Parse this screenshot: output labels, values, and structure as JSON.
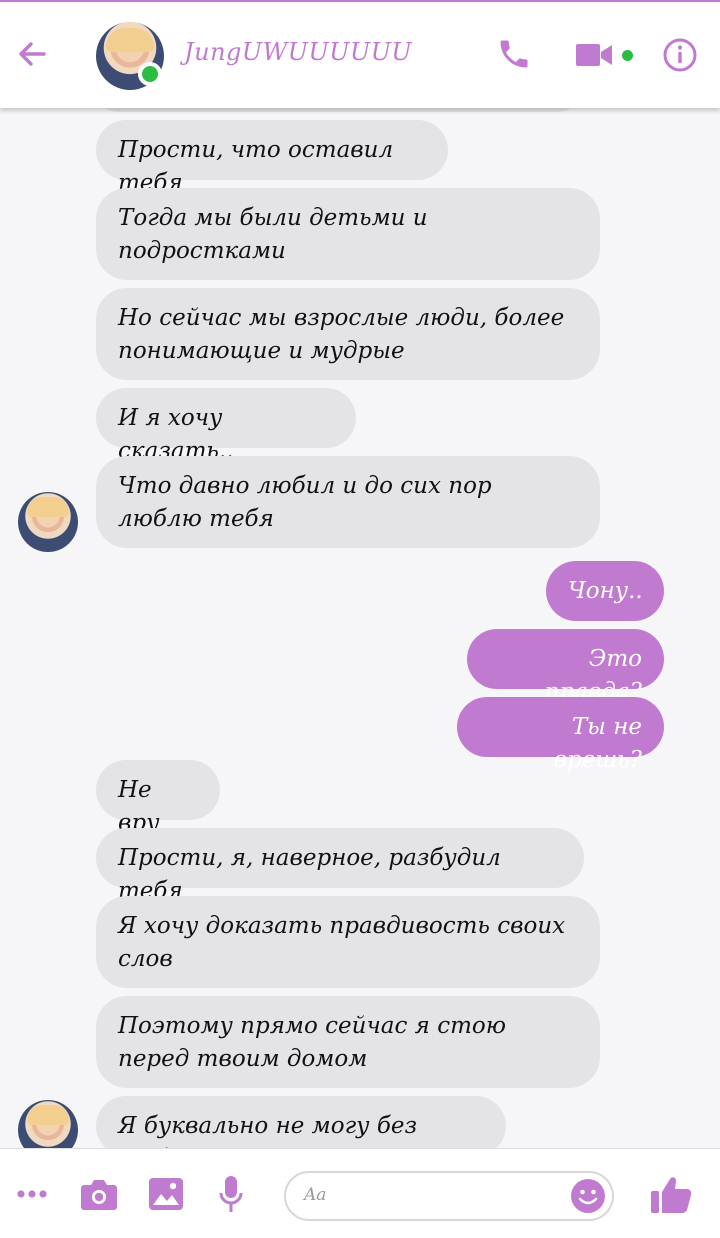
{
  "header": {
    "contact_name": "JungUWUUUUUU",
    "accent_color": "#c07ad0",
    "online_color": "#2bbd41",
    "icons": [
      "back-arrow-icon",
      "phone-icon",
      "video-camera-icon",
      "info-icon"
    ]
  },
  "messages": [
    {
      "side": "in",
      "text": "Прости, что оставил тебя"
    },
    {
      "side": "in",
      "text": "Тогда мы были детьми и подростками"
    },
    {
      "side": "in",
      "text": "Но сейчас мы взрослые люди, более понимающие и мудрые"
    },
    {
      "side": "in",
      "text": "И я хочу сказать.."
    },
    {
      "side": "in",
      "text": "Что давно любил и до сих пор люблю тебя"
    },
    {
      "side": "out",
      "text": "Чону.."
    },
    {
      "side": "out",
      "text": "Это правда?"
    },
    {
      "side": "out",
      "text": "Ты не врешь?"
    },
    {
      "side": "in",
      "text": "Не вру"
    },
    {
      "side": "in",
      "text": "Прости, я, наверное, разбудил тебя"
    },
    {
      "side": "in",
      "text": "Я хочу доказать правдивость своих слов"
    },
    {
      "side": "in",
      "text": "Поэтому прямо сейчас я стою перед твоим домом"
    },
    {
      "side": "in",
      "text": "Я буквально не могу без тебя"
    }
  ],
  "composer": {
    "placeholder": "Aa",
    "icons": [
      "more-dots-icon",
      "camera-icon",
      "image-icon",
      "microphone-icon",
      "emoji-icon",
      "thumbs-up-icon"
    ]
  }
}
